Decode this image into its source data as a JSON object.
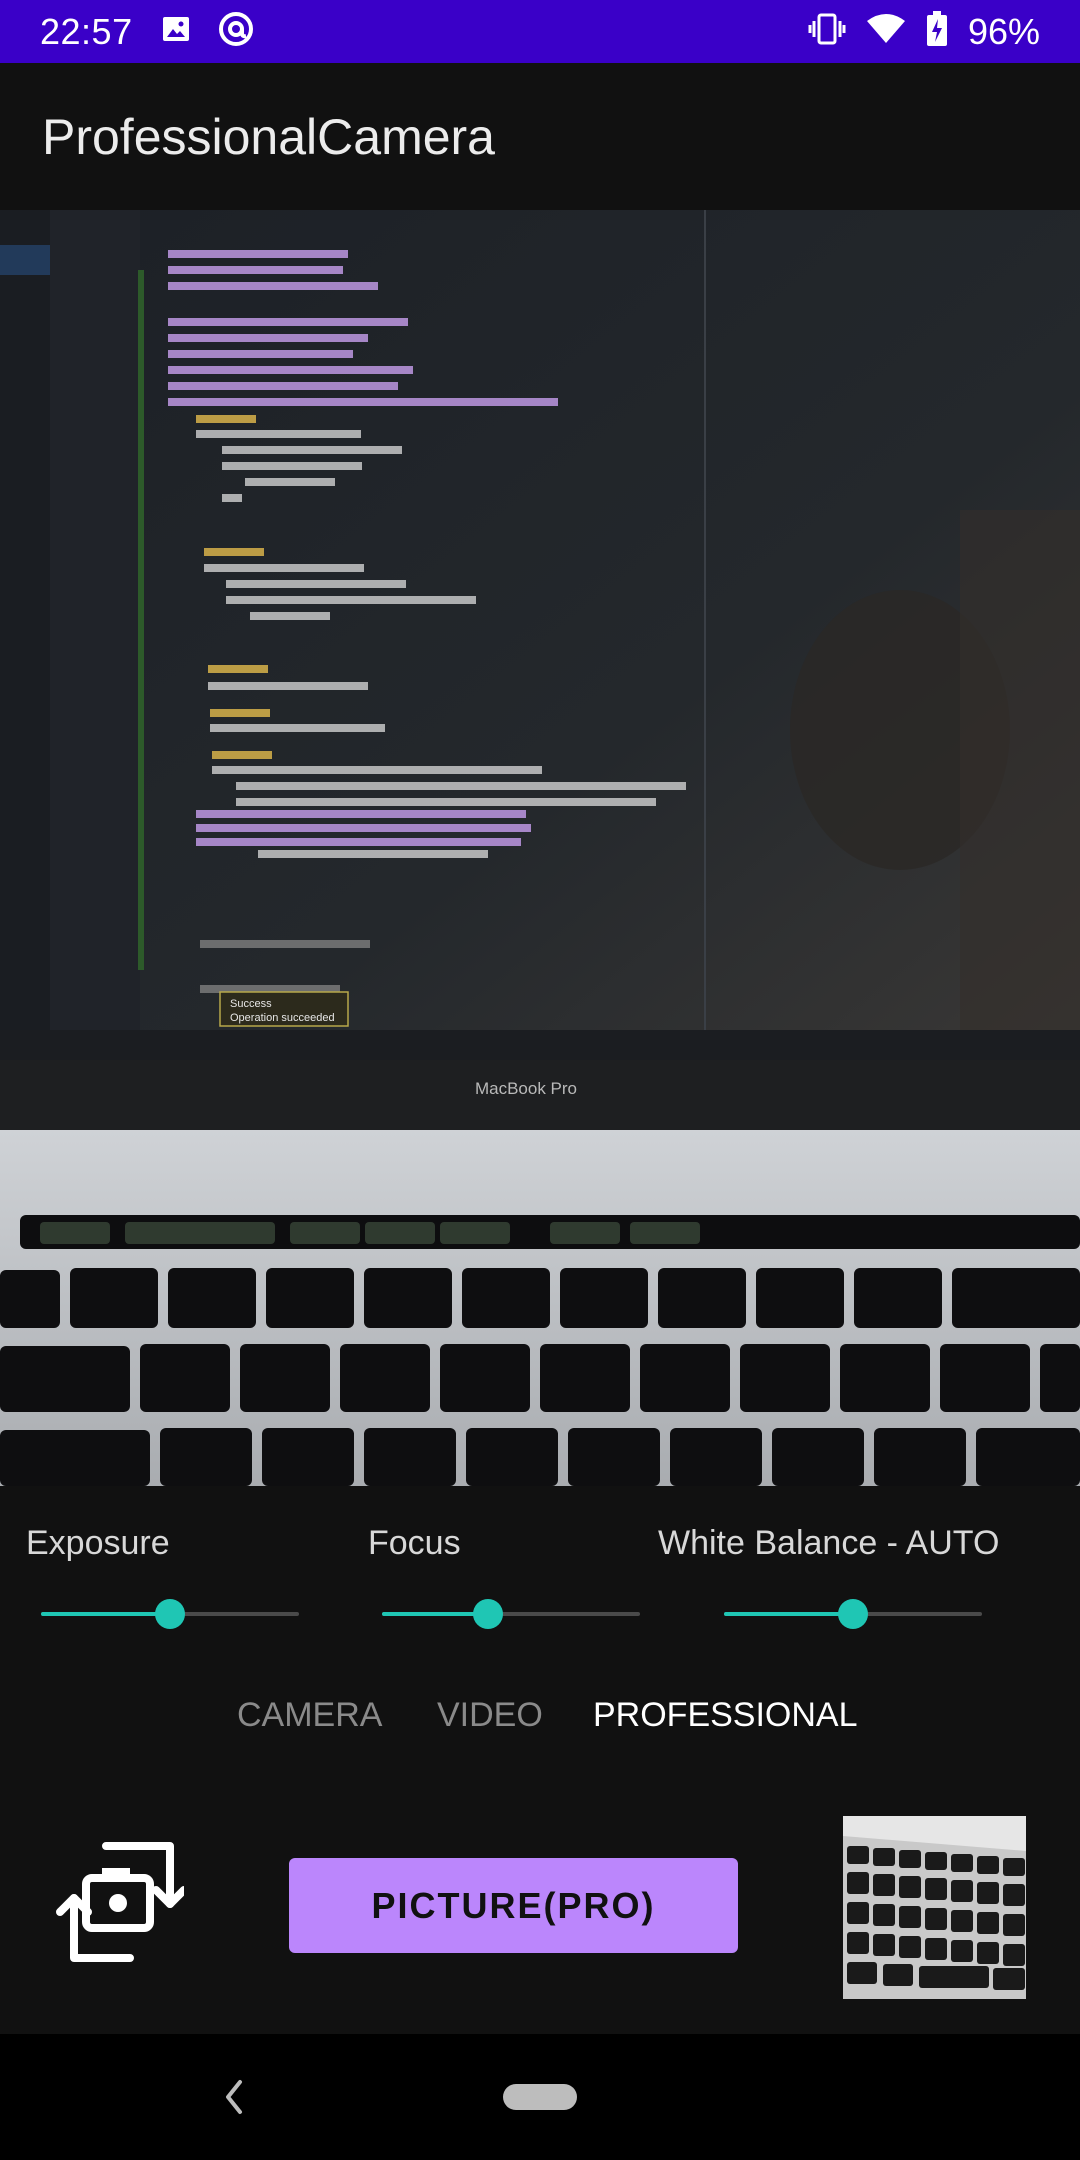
{
  "status_bar": {
    "time": "22:57",
    "battery": "96%",
    "icons": [
      "image-icon",
      "at-sign-icon",
      "vibrate-icon",
      "wifi-icon",
      "battery-charging-icon"
    ]
  },
  "app_bar": {
    "title": "ProfessionalCamera"
  },
  "preview": {
    "laptop_label": "MacBook Pro",
    "toast_title": "Success",
    "toast_message": "Operation succeeded"
  },
  "controls": {
    "exposure": {
      "label": "Exposure",
      "value_fraction": 0.5
    },
    "focus": {
      "label": "Focus",
      "value_fraction": 0.41
    },
    "white_balance": {
      "label": "White Balance - AUTO",
      "value_fraction": 0.5
    }
  },
  "modes": [
    {
      "label": "CAMERA",
      "active": false
    },
    {
      "label": "VIDEO",
      "active": false
    },
    {
      "label": "PROFESSIONAL",
      "active": true
    }
  ],
  "actions": {
    "shutter_label": "PICTURE(PRO)",
    "switch_camera_icon": "switch-camera-icon",
    "thumbnail": "last-photo-thumbnail"
  },
  "colors": {
    "status_bar": "#3a00c8",
    "accent": "#1fc6b4",
    "primary_button": "#bb86fc",
    "background": "#111111"
  }
}
